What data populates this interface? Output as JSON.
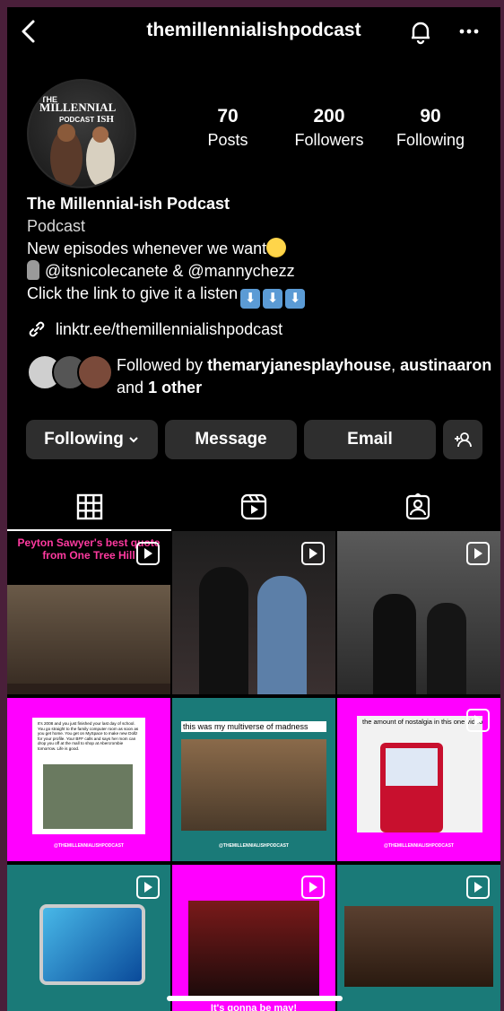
{
  "header": {
    "username": "themillennialishpodcast"
  },
  "profile": {
    "avatar_icon": "podcast-logo-avatar",
    "avatar_text": "THE MILLENNIAL PODCAST ISH",
    "stats": [
      {
        "value": "70",
        "label": "Posts"
      },
      {
        "value": "200",
        "label": "Followers"
      },
      {
        "value": "90",
        "label": "Following"
      }
    ],
    "name": "The Millennial-ish Podcast",
    "category": "Podcast",
    "bio_line1": "New episodes whenever we want",
    "bio_line2": "@itsnicolecanete & @mannychezz",
    "bio_line3": "Click the link to give it a listen",
    "link": "linktr.ee/themillennialishpodcast",
    "followed_by_prefix": "Followed by",
    "followed_by_user1": "themaryjanesplayhouse",
    "followed_by_user2": "austinaaron",
    "followed_by_and": "and",
    "followed_by_other": "1 other"
  },
  "actions": {
    "following": "Following",
    "message": "Message",
    "email": "Email"
  },
  "tabs": [
    "grid-icon",
    "reels-icon",
    "tagged-icon"
  ],
  "grid": [
    {
      "caption": "Peyton Sawyer's best quote from One Tree Hill",
      "bg": "#2b1f1a",
      "reel": true
    },
    {
      "caption": "",
      "bg": "#2a2a2a",
      "reel": true
    },
    {
      "caption": "",
      "bg": "#6b6b6b",
      "reel": true
    },
    {
      "caption": "It's 2008 and you just finished your last day of school. You go straight to the family computer room as soon as you get home. You get on MySpace to make new Dollz for your profile. Your BFF calls and says her mom can drop you off at the mall to shop at Abercrombie tomorrow. Life is good.",
      "bg": "#ff00ff",
      "reel": false
    },
    {
      "caption": "this was my multiverse of madness",
      "bg": "#1a7a78",
      "reel": false
    },
    {
      "caption": "the amount of nostalgia in this one video",
      "bg": "#ff00ff",
      "reel": true
    },
    {
      "caption": "",
      "bg": "#1a7a78",
      "reel": true
    },
    {
      "caption": "It's gonna be may!",
      "bg": "#ff00ff",
      "reel": true
    },
    {
      "caption": "",
      "bg": "#1a7a78",
      "reel": true
    }
  ],
  "grid_footer": "@THEMILLENNIALISHPODCAST"
}
